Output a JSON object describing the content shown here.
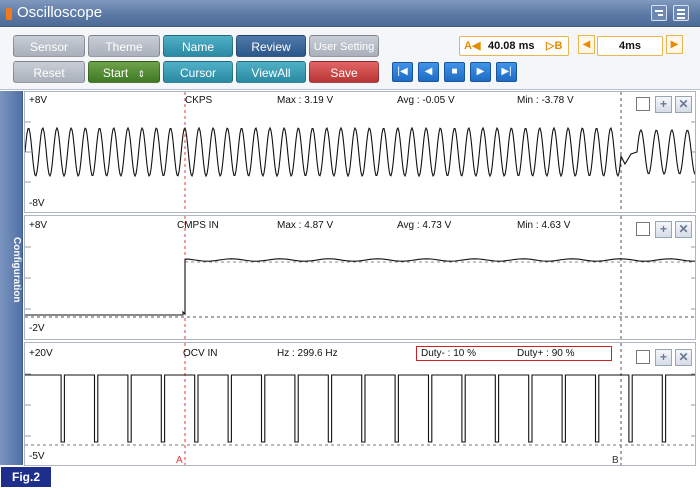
{
  "window": {
    "title": "Oscilloscope"
  },
  "toolbar": {
    "row1": {
      "sensor": "Sensor",
      "theme": "Theme",
      "name": "Name",
      "review": "Review",
      "user_setting": "User Setting"
    },
    "row2": {
      "reset": "Reset",
      "start": "Start",
      "cursor": "Cursor",
      "viewall": "ViewAll",
      "save": "Save"
    },
    "cursor_a_label": "A◀",
    "cursor_value": "40.08 ms",
    "cursor_b_label": "▷B",
    "time_div": "4ms"
  },
  "sidebar": {
    "label": "Configuration"
  },
  "channels": [
    {
      "ymax": "+8V",
      "ymin": "-8V",
      "name": "CKPS",
      "stat1": "Max : 3.19 V",
      "stat2": "Avg : -0.05 V",
      "stat3": "Min : -3.78 V"
    },
    {
      "ymax": "+8V",
      "ymin": "-2V",
      "name": "CMPS IN",
      "stat1": "Max : 4.87 V",
      "stat2": "Avg : 4.73 V",
      "stat3": "Min : 4.63 V"
    },
    {
      "ymax": "+20V",
      "ymin": "-5V",
      "name": "OCV IN",
      "stat1": "Hz : 299.6 Hz",
      "stat2": "Duty- : 10 %",
      "stat3": "Duty+ : 90 %"
    }
  ],
  "cursors": {
    "a": "A",
    "b": "B"
  },
  "figure_label": "Fig.2",
  "colors": {
    "cursor_a": "#e23b3b",
    "cursor_b": "#555555",
    "trace": "#111111"
  },
  "icons": [
    "close-icon",
    "menu-icon",
    "checkbox-icon",
    "plus-icon",
    "x-icon",
    "first-icon",
    "prev-icon",
    "stop-icon",
    "next-icon",
    "last-icon"
  ]
}
